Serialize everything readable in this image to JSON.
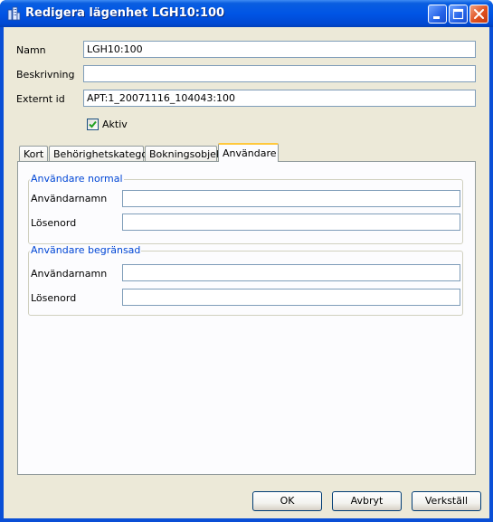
{
  "window": {
    "title": "Redigera lägenhet LGH10:100",
    "controls": [
      "minimize-icon",
      "maximize-icon",
      "close-icon"
    ]
  },
  "form": {
    "name_label": "Namn",
    "name_value": "LGH10:100",
    "description_label": "Beskrivning",
    "description_value": "",
    "external_id_label": "Externt id",
    "external_id_value": "APT:1_20071116_104043:100",
    "active_label": "Aktiv",
    "active_checked": true
  },
  "tabs": [
    {
      "label": "Kort"
    },
    {
      "label": "Behörighetskategori"
    },
    {
      "label": "Bokningsobjekt"
    },
    {
      "label": "Användare"
    }
  ],
  "active_tab": "Användare",
  "groups": {
    "normal": {
      "title": "Användare normal",
      "username_label": "Användarnamn",
      "username_value": "",
      "password_label": "Lösenord",
      "password_value": ""
    },
    "restricted": {
      "title": "Användare begränsad",
      "username_label": "Användarnamn",
      "username_value": "",
      "password_label": "Lösenord",
      "password_value": ""
    }
  },
  "buttons": {
    "ok": "OK",
    "cancel": "Avbryt",
    "apply": "Verkställ"
  },
  "colors": {
    "titlebar": "#0055e5",
    "group_title": "#0046d5",
    "active_tab_accent": "#ffc83c",
    "dialog_bg": "#ece9d8"
  }
}
